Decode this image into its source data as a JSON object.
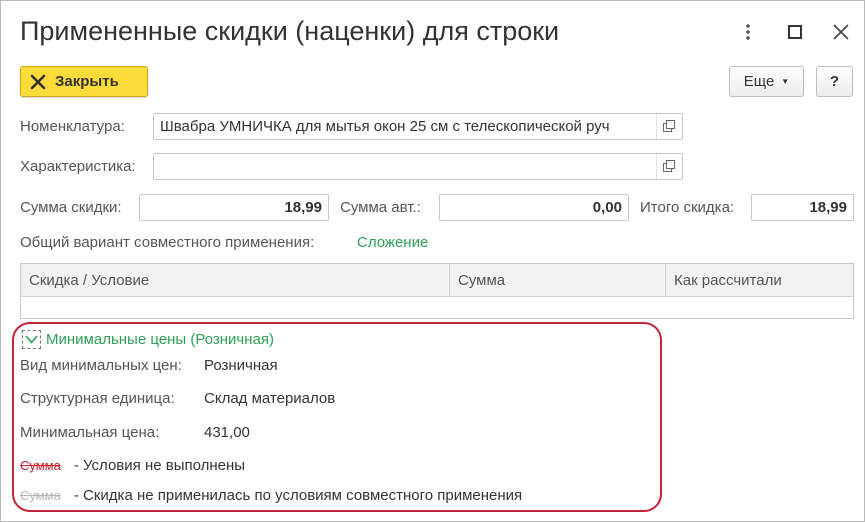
{
  "window": {
    "title": "Примененные скидки (наценки) для строки"
  },
  "toolbar": {
    "close_label": "Закрыть",
    "more_label": "Еще",
    "help_label": "?"
  },
  "fields": {
    "nomenclature_label": "Номенклатура:",
    "nomenclature_value": "Швабра УМНИЧКА для мытья окон 25 см с телескопической руч",
    "characteristic_label": "Характеристика:",
    "characteristic_value": "",
    "discount_sum_label": "Сумма скидки:",
    "discount_sum_value": "18,99",
    "auto_sum_label": "Сумма авт.:",
    "auto_sum_value": "0,00",
    "total_discount_label": "Итого скидка:",
    "total_discount_value": "18,99",
    "joint_variant_label": "Общий вариант совместного применения:",
    "joint_variant_value": "Сложение"
  },
  "table": {
    "columns": [
      "Скидка / Условие",
      "Сумма",
      "Как рассчитали"
    ],
    "rows": []
  },
  "min_prices": {
    "group_title": "Минимальные цены (Розничная)",
    "kind_label": "Вид минимальных цен:",
    "kind_value": "Розничная",
    "unit_label": "Структурная единица:",
    "unit_value": "Склад материалов",
    "price_label": "Минимальная цена:",
    "price_value": "431,00"
  },
  "legend": {
    "strike_word": "Сумма",
    "not_met_text": "- Условия не выполнены",
    "not_applied_text": "- Скидка не применилась по условиям совместного применения"
  },
  "colors": {
    "accent_yellow": "#fbdc3a",
    "link_green": "#2e9f55",
    "highlight_red": "#c0233a"
  }
}
